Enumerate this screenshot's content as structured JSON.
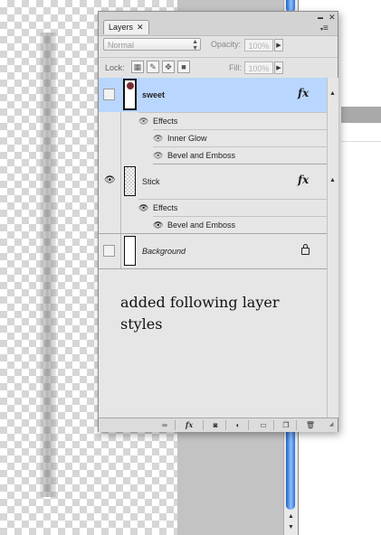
{
  "panel": {
    "tab_label": "Layers",
    "tab_close": "✕",
    "minimize_glyph": "▬",
    "close_glyph": "✕",
    "menu_glyph": "≡"
  },
  "controls": {
    "blend_mode": "Normal",
    "opacity_label": "Opacity:",
    "opacity_value": "100%",
    "lock_label": "Lock:",
    "fill_label": "Fill:",
    "fill_value": "100%"
  },
  "layers": [
    {
      "name": "sweet",
      "selected": true,
      "visible": false,
      "effects_label": "Effects",
      "effects": [
        "Inner Glow",
        "Bevel and Emboss"
      ]
    },
    {
      "name": "Stick",
      "selected": false,
      "visible": true,
      "effects_label": "Effects",
      "effects": [
        "Bevel and Emboss"
      ]
    },
    {
      "name": "Background",
      "selected": false,
      "visible": false,
      "locked": true
    }
  ],
  "fx_label": "fx",
  "note": {
    "line1": "added following layer",
    "line2": "styles"
  },
  "colors": {
    "selection": "#b9d6fe",
    "scroll_thumb": "#3a7ee0",
    "panel_bg": "#e6e6e6"
  }
}
